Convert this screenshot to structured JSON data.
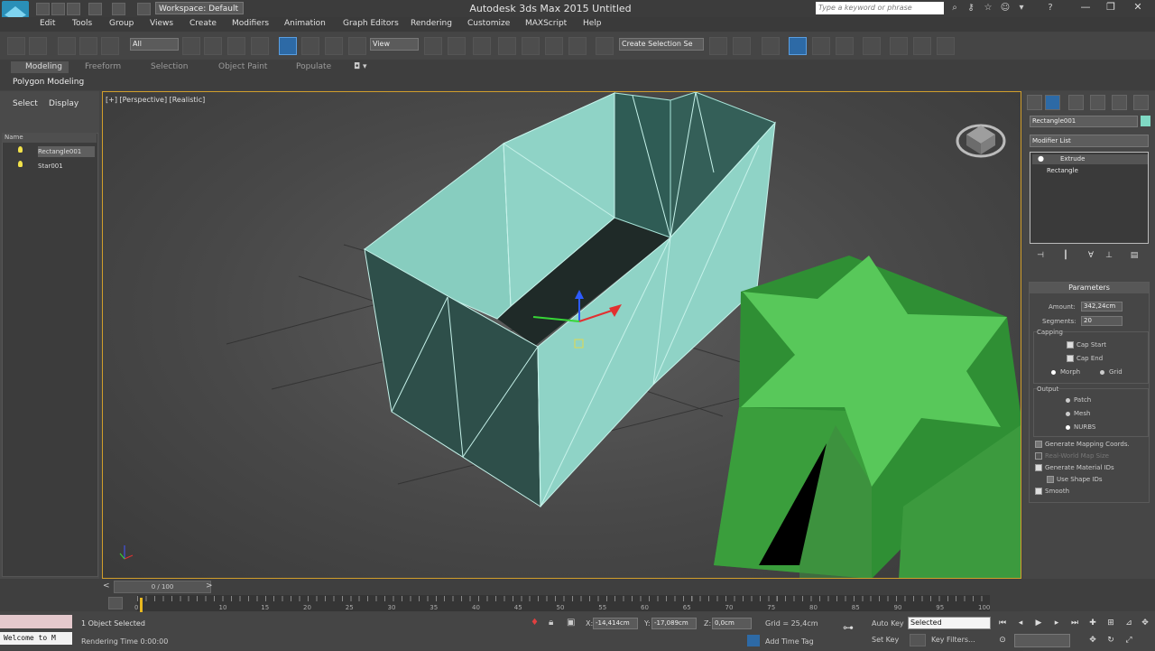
{
  "titlebar": {
    "workspace": "Workspace: Default",
    "app_title": "Autodesk 3ds Max  2015     Untitled",
    "search_placeholder": "Type a keyword or phrase"
  },
  "menu": [
    "Edit",
    "Tools",
    "Group",
    "Views",
    "Create",
    "Modifiers",
    "Animation",
    "Graph Editors",
    "Rendering",
    "Customize",
    "MAXScript",
    "Help"
  ],
  "toolbar": {
    "selection_filter": "All",
    "ref_coord": "View",
    "named_selection": "Create Selection Se"
  },
  "ribbon": {
    "tabs": [
      "Modeling",
      "Freeform",
      "Selection",
      "Object Paint",
      "Populate"
    ],
    "panel": "Polygon Modeling"
  },
  "scene_explorer": {
    "tabs": [
      "Select",
      "Display"
    ],
    "column": "Name",
    "items": [
      {
        "name": "Rectangle001",
        "selected": true
      },
      {
        "name": "Star001",
        "selected": false
      }
    ]
  },
  "viewport": {
    "label": "[+] [Perspective] [Realistic]",
    "box_color": "#8fd3c6",
    "star_color": "#58c85a"
  },
  "command_panel": {
    "object_name": "Rectangle001",
    "object_color": "#7fd9c4",
    "modifier_list": "Modifier List",
    "stack": [
      "Extrude",
      "Rectangle"
    ],
    "parameters": {
      "title": "Parameters",
      "amount_label": "Amount:",
      "amount": "342,24cm",
      "segments_label": "Segments:",
      "segments": "20",
      "capping_label": "Capping",
      "cap_start": "Cap Start",
      "cap_end": "Cap End",
      "morph": "Morph",
      "grid": "Grid",
      "output_label": "Output",
      "patch": "Patch",
      "mesh": "Mesh",
      "nurbs": "NURBS",
      "gen_mapping": "Generate Mapping Coords.",
      "real_world": "Real-World Map Size",
      "gen_material": "Generate Material IDs",
      "use_shape": "Use Shape IDs",
      "smooth": "Smooth"
    }
  },
  "timeline": {
    "slider": "0 / 100",
    "ticks": [
      "0",
      "10",
      "15",
      "20",
      "25",
      "30",
      "35",
      "40",
      "45",
      "50",
      "55",
      "60",
      "65",
      "70",
      "75",
      "80",
      "85",
      "90",
      "95",
      "100"
    ]
  },
  "status": {
    "maxscript_output": "Welcome to M",
    "objects_selected": "1 Object Selected",
    "render_time": "Rendering Time  0:00:00",
    "x": "-14,414cm",
    "y": "-17,089cm",
    "z": "0,0cm",
    "grid": "Grid = 25,4cm",
    "add_time_tag": "Add Time Tag",
    "auto_key": "Auto Key",
    "selected": "Selected",
    "set_key": "Set Key",
    "key_filters": "Key Filters..."
  }
}
